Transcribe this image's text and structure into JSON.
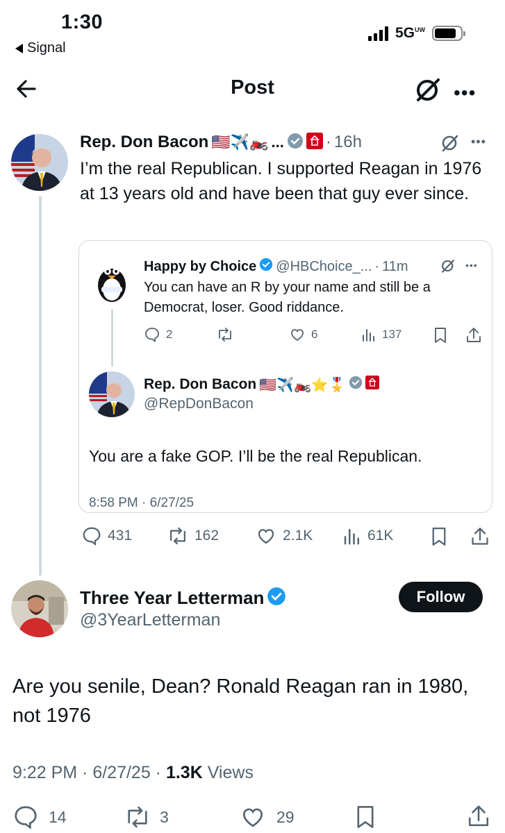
{
  "status_bar": {
    "time": "1:30",
    "back_app": "Signal",
    "network": "5G",
    "network_sup": "UW"
  },
  "header": {
    "title": "Post"
  },
  "main_post": {
    "author": "Rep. Don Bacon",
    "flags": "🇺🇸✈️🏍️",
    "ellipsis": "...",
    "time": "16h",
    "text": "I’m the real Republican. I supported Reagan in 1976 at 13 years old and have been that guy ever since.",
    "quote": {
      "inner": {
        "author": "Happy by Choice",
        "handle": "@HBChoice_...",
        "time": "11m",
        "text": "You can have an R by your name and still be a Democrat, loser. Good riddance.",
        "stats": {
          "replies": "2",
          "likes": "6",
          "views": "137"
        }
      },
      "author": "Rep. Don Bacon",
      "flags": "🇺🇸✈️🏍️⭐🎖️",
      "handle": "@RepDonBacon",
      "text": "You are a fake GOP. I’ll be the real Republican.",
      "timestamp": "8:58 PM · 6/27/25"
    },
    "stats": {
      "replies": "431",
      "reposts": "162",
      "likes": "2.1K",
      "views": "61K"
    }
  },
  "reply": {
    "author": "Three Year Letterman",
    "handle": "@3YearLetterman",
    "follow_label": "Follow",
    "text": "Are you senile, Dean? Ronald Reagan ran in 1980, not 1976",
    "time_date": "9:22 PM · 6/27/25 · ",
    "views_count": "1.3K",
    "views_label": " Views",
    "stats": {
      "replies": "14",
      "reposts": "3",
      "likes": "29"
    }
  },
  "colors": {
    "verified": "#1d9bf0",
    "gray_badge": "#829aab",
    "gop_red": "#d0021b",
    "text": "#0f1419",
    "muted": "#536471"
  }
}
